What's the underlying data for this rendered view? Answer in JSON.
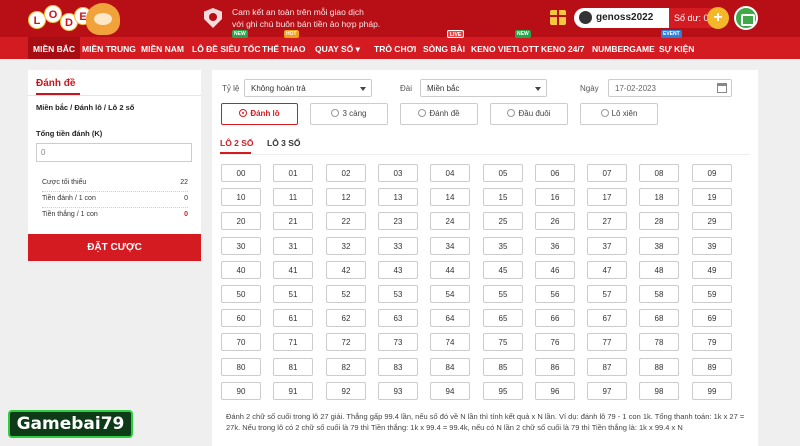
{
  "logo": {
    "letters": [
      "L",
      "O",
      "D",
      "E"
    ]
  },
  "header": {
    "commitment_line1": "Cam kết an toàn trên mỗi giao dịch",
    "commitment_line2": "với ghi chú buôn bán tiền ảo hợp pháp.",
    "username": "genoss2022",
    "balance": "Số dư: 0 K",
    "plus": "+"
  },
  "nav": [
    {
      "label": "MIỀN BẮC",
      "active": true
    },
    {
      "label": "MIỀN TRUNG"
    },
    {
      "label": "MIỀN NAM"
    },
    {
      "label": "LÔ ĐỀ SIÊU TỐC",
      "badge": "NEW"
    },
    {
      "label": "THỂ THAO",
      "badge": "HOT"
    },
    {
      "label": "QUAY SỐ ▾"
    },
    {
      "label": "TRÒ CHƠI"
    },
    {
      "label": "SÒNG BÀI",
      "badge": "LIVE"
    },
    {
      "label": "KENO VIETLOTT",
      "badge": "NEW"
    },
    {
      "label": "KENO 24/7"
    },
    {
      "label": "NUMBERGAME"
    },
    {
      "label": "SỰ KIỆN",
      "badge": "EVENT"
    }
  ],
  "sidebar": {
    "title": "Đánh đề",
    "path": "Miền bắc / Đánh lô / Lô 2 số",
    "total_label": "Tổng tiền đánh (K)",
    "total_value": "0",
    "stats": [
      {
        "label": "Cược tối thiểu",
        "value": "22"
      },
      {
        "label": "Tiền đánh / 1 con",
        "value": "0"
      },
      {
        "label": "Tiền thắng / 1 con",
        "value": "0"
      }
    ],
    "bet_button": "ĐẶT CƯỢC"
  },
  "filters": {
    "ratio_label": "Tỷ lệ",
    "ratio_value": "Không hoàn trả",
    "region_label": "Đài",
    "region_value": "Miền bắc",
    "date_label": "Ngày",
    "date_value": "17-02-2023"
  },
  "bet_types": [
    "Đánh lô",
    "3 càng",
    "Đánh đề",
    "Đầu đuôi",
    "Lô xiên"
  ],
  "subtabs": [
    "LÔ 2 SỐ",
    "LÔ 3 SỐ"
  ],
  "numbers": [
    "00",
    "01",
    "02",
    "03",
    "04",
    "05",
    "06",
    "07",
    "08",
    "09",
    "10",
    "11",
    "12",
    "13",
    "14",
    "15",
    "16",
    "17",
    "18",
    "19",
    "20",
    "21",
    "22",
    "23",
    "24",
    "25",
    "26",
    "27",
    "28",
    "29",
    "30",
    "31",
    "32",
    "33",
    "34",
    "35",
    "36",
    "37",
    "38",
    "39",
    "40",
    "41",
    "42",
    "43",
    "44",
    "45",
    "46",
    "47",
    "48",
    "49",
    "50",
    "51",
    "52",
    "53",
    "54",
    "55",
    "56",
    "57",
    "58",
    "59",
    "60",
    "61",
    "62",
    "63",
    "64",
    "65",
    "66",
    "67",
    "68",
    "69",
    "70",
    "71",
    "72",
    "73",
    "74",
    "75",
    "76",
    "77",
    "78",
    "79",
    "80",
    "81",
    "82",
    "83",
    "84",
    "85",
    "86",
    "87",
    "88",
    "89",
    "90",
    "91",
    "92",
    "93",
    "94",
    "95",
    "96",
    "97",
    "98",
    "99"
  ],
  "note": "Đánh 2 chữ số cuối trong lô 27 giải. Thắng gấp 99.4 lần, nếu số đó về N lần thì tính kết quả x N lần. Ví dụ: đánh lô 79 - 1 con 1k. Tổng thanh toán: 1k x 27 = 27k. Nếu trong lô có 2 chữ số cuối là 79 thì Tiền thắng: 1k x 99.4 = 99.4k, nếu có N lần 2 chữ số cuối là 79 thì Tiền thắng là: 1k x 99.4 x N",
  "watermark": "Gamebai79"
}
